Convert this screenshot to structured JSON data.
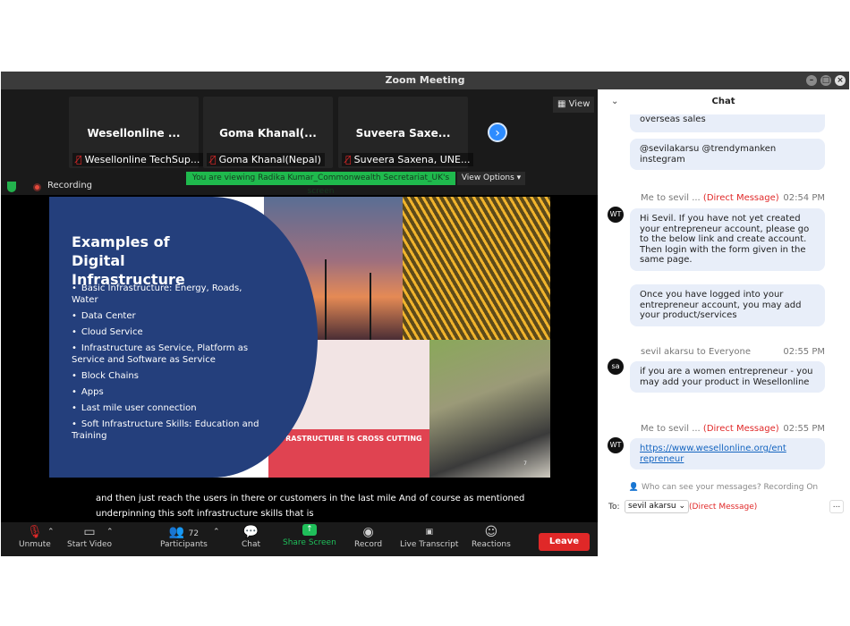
{
  "window": {
    "title": "Zoom Meeting"
  },
  "tiles": [
    {
      "name": "Wesellonline ...",
      "label": "Wesellonline TechSup..."
    },
    {
      "name": "Goma Khanal(...",
      "label": "Goma Khanal(Nepal)"
    },
    {
      "name": "Suveera Saxe...",
      "label": "Suveera Saxena, UNE..."
    }
  ],
  "view_label": "View",
  "recording_label": "Recording",
  "viewing_banner": "You are viewing Radika Kumar_Commonwealth Secretariat_UK's screen",
  "view_options_label": "View Options",
  "slide": {
    "title": "Examples of Digital Infrastructure",
    "bullets": [
      "Basic Infrastructure: Energy, Roads, Water",
      "Data Center",
      "Cloud Service",
      "Infrastructure as Service, Platform as Service and Software as Service",
      "Block Chains",
      "Apps",
      "Last mile user connection",
      "Soft Infrastructure Skills: Education and Training"
    ],
    "band_text": "INFRASTRUCTURE IS CROSS CUTTING",
    "page_num": "7"
  },
  "caption": {
    "line1": "and then just reach the users in there or customers in the last mile And of course as mentioned",
    "line2": "underpinning this soft infrastructure skills that is"
  },
  "toolbar": {
    "unmute": "Unmute",
    "start_video": "Start Video",
    "participants": "Participants",
    "participant_count": "72",
    "chat": "Chat",
    "share_screen": "Share Screen",
    "record": "Record",
    "live_transcript": "Live Transcript",
    "reactions": "Reactions",
    "leave": "Leave"
  },
  "chat": {
    "title": "Chat",
    "messages": [
      {
        "text": "overseas sales"
      },
      {
        "text": "@sevilakarsu @trendymanken instegram"
      },
      {
        "sender": "Me to sevil ...",
        "dm": "(Direct Message)",
        "time": "02:54 PM",
        "avatar": "WT",
        "text": "Hi Sevil. If you have not yet created your entrepreneur account, please go to the below link and create account. Then login with the form given in the same page."
      },
      {
        "text": "Once you have logged into your entrepreneur account, you may add your product/services"
      },
      {
        "sender": "sevil akarsu to Everyone",
        "time": "02:55 PM",
        "avatar": "sa",
        "text": "if you are a women entrepreneur - you may add your product in Wesellonline"
      },
      {
        "sender": "Me to sevil ...",
        "dm": "(Direct Message)",
        "time": "02:55 PM",
        "avatar": "WT",
        "link": "https://www.wesellonline.org/entrepreneur"
      }
    ],
    "privacy_text": "Who can see your messages? Recording On",
    "to_label": "To:",
    "to_value": "sevil akarsu",
    "to_dm": "(Direct Message)",
    "more": "..."
  }
}
